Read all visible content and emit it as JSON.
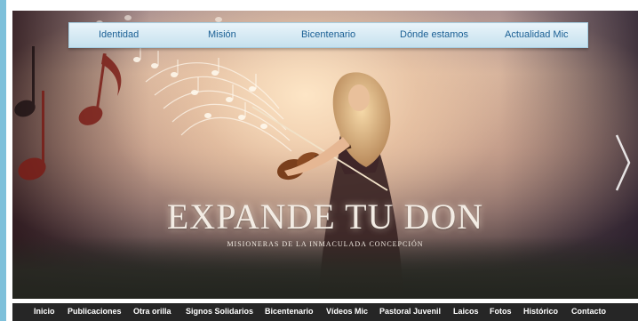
{
  "top_nav": {
    "items": [
      {
        "label": "Identidad"
      },
      {
        "label": "Misión"
      },
      {
        "label": "Bicentenario"
      },
      {
        "label": "Dónde estamos"
      },
      {
        "label": "Actualidad Mic"
      }
    ]
  },
  "slide": {
    "title": "EXPANDE TU DON",
    "subtitle": "MISIONERAS DE LA INMACULADA CONCEPCIÓN",
    "next_icon": "chevron-right-icon"
  },
  "bottom_nav": {
    "items": [
      {
        "label": "Inicio"
      },
      {
        "label": "Publicaciones"
      },
      {
        "label": "Otra orilla"
      },
      {
        "label": "Signos Solidarios"
      },
      {
        "label": "Bicentenario"
      },
      {
        "label": "Vídeos Mic"
      },
      {
        "label": "Pastoral Juvenil"
      },
      {
        "label": "Laicos"
      },
      {
        "label": "Fotos"
      },
      {
        "label": "Histórico"
      },
      {
        "label": "Contacto"
      }
    ]
  },
  "colors": {
    "accent": "#7ec0da",
    "nav_text": "#1a5f94",
    "bottom_bar": "#262626"
  }
}
